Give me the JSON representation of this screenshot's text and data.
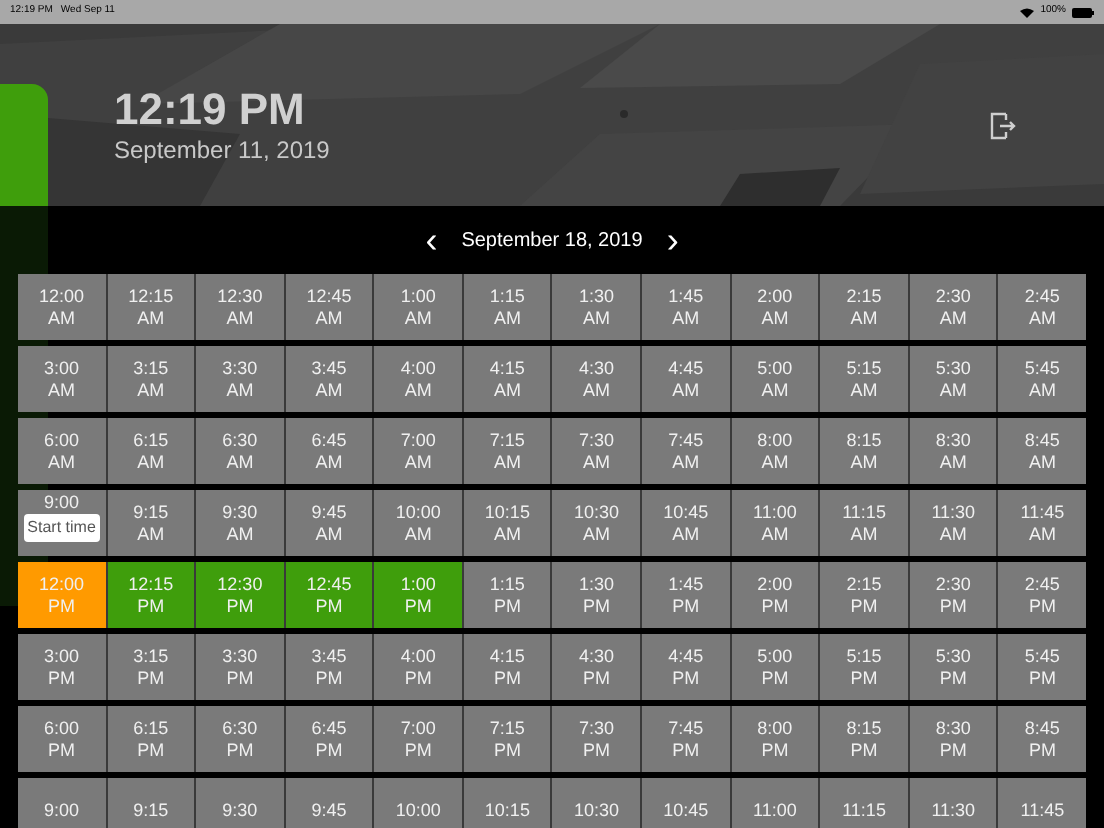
{
  "status_bar": {
    "time": "12:19 PM",
    "date": "Wed Sep 11",
    "battery": "100%"
  },
  "header": {
    "time": "12:19 PM",
    "date": "September 11, 2019"
  },
  "date_nav": {
    "prev": "‹",
    "label": "September 18, 2019",
    "next": "›"
  },
  "slots": [
    [
      {
        "time": "12:00",
        "period": "AM",
        "start": false,
        "selected": false
      },
      {
        "time": "12:15",
        "period": "AM",
        "start": false,
        "selected": false
      },
      {
        "time": "12:30",
        "period": "AM",
        "start": false,
        "selected": false
      },
      {
        "time": "12:45",
        "period": "AM",
        "start": false,
        "selected": false
      },
      {
        "time": "1:00",
        "period": "AM",
        "start": false,
        "selected": false
      },
      {
        "time": "1:15",
        "period": "AM",
        "start": false,
        "selected": false
      },
      {
        "time": "1:30",
        "period": "AM",
        "start": false,
        "selected": false
      },
      {
        "time": "1:45",
        "period": "AM",
        "start": false,
        "selected": false
      },
      {
        "time": "2:00",
        "period": "AM",
        "start": false,
        "selected": false
      },
      {
        "time": "2:15",
        "period": "AM",
        "start": false,
        "selected": false
      },
      {
        "time": "2:30",
        "period": "AM",
        "start": false,
        "selected": false
      },
      {
        "time": "2:45",
        "period": "AM",
        "start": false,
        "selected": false
      }
    ],
    [
      {
        "time": "3:00",
        "period": "AM",
        "start": false,
        "selected": false
      },
      {
        "time": "3:15",
        "period": "AM",
        "start": false,
        "selected": false
      },
      {
        "time": "3:30",
        "period": "AM",
        "start": false,
        "selected": false
      },
      {
        "time": "3:45",
        "period": "AM",
        "start": false,
        "selected": false
      },
      {
        "time": "4:00",
        "period": "AM",
        "start": false,
        "selected": false
      },
      {
        "time": "4:15",
        "period": "AM",
        "start": false,
        "selected": false
      },
      {
        "time": "4:30",
        "period": "AM",
        "start": false,
        "selected": false
      },
      {
        "time": "4:45",
        "period": "AM",
        "start": false,
        "selected": false
      },
      {
        "time": "5:00",
        "period": "AM",
        "start": false,
        "selected": false
      },
      {
        "time": "5:15",
        "period": "AM",
        "start": false,
        "selected": false
      },
      {
        "time": "5:30",
        "period": "AM",
        "start": false,
        "selected": false
      },
      {
        "time": "5:45",
        "period": "AM",
        "start": false,
        "selected": false
      }
    ],
    [
      {
        "time": "6:00",
        "period": "AM",
        "start": false,
        "selected": false
      },
      {
        "time": "6:15",
        "period": "AM",
        "start": false,
        "selected": false
      },
      {
        "time": "6:30",
        "period": "AM",
        "start": false,
        "selected": false
      },
      {
        "time": "6:45",
        "period": "AM",
        "start": false,
        "selected": false
      },
      {
        "time": "7:00",
        "period": "AM",
        "start": false,
        "selected": false
      },
      {
        "time": "7:15",
        "period": "AM",
        "start": false,
        "selected": false
      },
      {
        "time": "7:30",
        "period": "AM",
        "start": false,
        "selected": false
      },
      {
        "time": "7:45",
        "period": "AM",
        "start": false,
        "selected": false
      },
      {
        "time": "8:00",
        "period": "AM",
        "start": false,
        "selected": false
      },
      {
        "time": "8:15",
        "period": "AM",
        "start": false,
        "selected": false
      },
      {
        "time": "8:30",
        "period": "AM",
        "start": false,
        "selected": false
      },
      {
        "time": "8:45",
        "period": "AM",
        "start": false,
        "selected": false
      }
    ],
    [
      {
        "time": "9:00",
        "tooltip": "Start time",
        "start": false,
        "selected": false
      },
      {
        "time": "9:15",
        "period": "AM",
        "start": false,
        "selected": false
      },
      {
        "time": "9:30",
        "period": "AM",
        "start": false,
        "selected": false
      },
      {
        "time": "9:45",
        "period": "AM",
        "start": false,
        "selected": false
      },
      {
        "time": "10:00",
        "period": "AM",
        "start": false,
        "selected": false
      },
      {
        "time": "10:15",
        "period": "AM",
        "start": false,
        "selected": false
      },
      {
        "time": "10:30",
        "period": "AM",
        "start": false,
        "selected": false
      },
      {
        "time": "10:45",
        "period": "AM",
        "start": false,
        "selected": false
      },
      {
        "time": "11:00",
        "period": "AM",
        "start": false,
        "selected": false
      },
      {
        "time": "11:15",
        "period": "AM",
        "start": false,
        "selected": false
      },
      {
        "time": "11:30",
        "period": "AM",
        "start": false,
        "selected": false
      },
      {
        "time": "11:45",
        "period": "AM",
        "start": false,
        "selected": false
      }
    ],
    [
      {
        "time": "12:00",
        "period": "PM",
        "start": true,
        "selected": true
      },
      {
        "time": "12:15",
        "period": "PM",
        "start": false,
        "selected": true
      },
      {
        "time": "12:30",
        "period": "PM",
        "start": false,
        "selected": true
      },
      {
        "time": "12:45",
        "period": "PM",
        "start": false,
        "selected": true
      },
      {
        "time": "1:00",
        "period": "PM",
        "start": false,
        "selected": true
      },
      {
        "time": "1:15",
        "period": "PM",
        "start": false,
        "selected": false
      },
      {
        "time": "1:30",
        "period": "PM",
        "start": false,
        "selected": false
      },
      {
        "time": "1:45",
        "period": "PM",
        "start": false,
        "selected": false
      },
      {
        "time": "2:00",
        "period": "PM",
        "start": false,
        "selected": false
      },
      {
        "time": "2:15",
        "period": "PM",
        "start": false,
        "selected": false
      },
      {
        "time": "2:30",
        "period": "PM",
        "start": false,
        "selected": false
      },
      {
        "time": "2:45",
        "period": "PM",
        "start": false,
        "selected": false
      }
    ],
    [
      {
        "time": "3:00",
        "period": "PM",
        "start": false,
        "selected": false
      },
      {
        "time": "3:15",
        "period": "PM",
        "start": false,
        "selected": false
      },
      {
        "time": "3:30",
        "period": "PM",
        "start": false,
        "selected": false
      },
      {
        "time": "3:45",
        "period": "PM",
        "start": false,
        "selected": false
      },
      {
        "time": "4:00",
        "period": "PM",
        "start": false,
        "selected": false
      },
      {
        "time": "4:15",
        "period": "PM",
        "start": false,
        "selected": false
      },
      {
        "time": "4:30",
        "period": "PM",
        "start": false,
        "selected": false
      },
      {
        "time": "4:45",
        "period": "PM",
        "start": false,
        "selected": false
      },
      {
        "time": "5:00",
        "period": "PM",
        "start": false,
        "selected": false
      },
      {
        "time": "5:15",
        "period": "PM",
        "start": false,
        "selected": false
      },
      {
        "time": "5:30",
        "period": "PM",
        "start": false,
        "selected": false
      },
      {
        "time": "5:45",
        "period": "PM",
        "start": false,
        "selected": false
      }
    ],
    [
      {
        "time": "6:00",
        "period": "PM",
        "start": false,
        "selected": false
      },
      {
        "time": "6:15",
        "period": "PM",
        "start": false,
        "selected": false
      },
      {
        "time": "6:30",
        "period": "PM",
        "start": false,
        "selected": false
      },
      {
        "time": "6:45",
        "period": "PM",
        "start": false,
        "selected": false
      },
      {
        "time": "7:00",
        "period": "PM",
        "start": false,
        "selected": false
      },
      {
        "time": "7:15",
        "period": "PM",
        "start": false,
        "selected": false
      },
      {
        "time": "7:30",
        "period": "PM",
        "start": false,
        "selected": false
      },
      {
        "time": "7:45",
        "period": "PM",
        "start": false,
        "selected": false
      },
      {
        "time": "8:00",
        "period": "PM",
        "start": false,
        "selected": false
      },
      {
        "time": "8:15",
        "period": "PM",
        "start": false,
        "selected": false
      },
      {
        "time": "8:30",
        "period": "PM",
        "start": false,
        "selected": false
      },
      {
        "time": "8:45",
        "period": "PM",
        "start": false,
        "selected": false
      }
    ],
    [
      {
        "time": "9:00",
        "start": false,
        "selected": false
      },
      {
        "time": "9:15",
        "start": false,
        "selected": false
      },
      {
        "time": "9:30",
        "start": false,
        "selected": false
      },
      {
        "time": "9:45",
        "start": false,
        "selected": false
      },
      {
        "time": "10:00",
        "start": false,
        "selected": false
      },
      {
        "time": "10:15",
        "start": false,
        "selected": false
      },
      {
        "time": "10:30",
        "start": false,
        "selected": false
      },
      {
        "time": "10:45",
        "start": false,
        "selected": false
      },
      {
        "time": "11:00",
        "start": false,
        "selected": false
      },
      {
        "time": "11:15",
        "start": false,
        "selected": false
      },
      {
        "time": "11:30",
        "start": false,
        "selected": false
      },
      {
        "time": "11:45",
        "start": false,
        "selected": false
      }
    ]
  ]
}
